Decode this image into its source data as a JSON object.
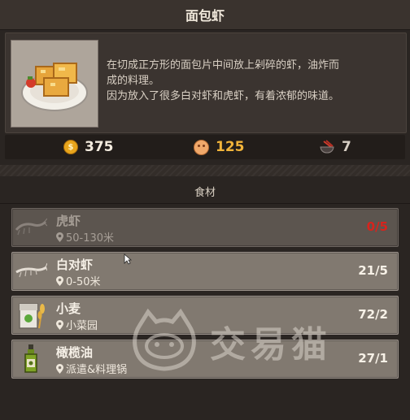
{
  "header": {
    "title": "面包虾"
  },
  "dish": {
    "description_line1": "在切成正方形的面包片中间放上剁碎的虾，油炸而",
    "description_line2": "成的料理。",
    "description_line3": "因为放入了很多白对虾和虎虾，有着浓郁的味道。"
  },
  "stats": {
    "coin": "375",
    "happiness": "125",
    "bowl": "7"
  },
  "section": {
    "title": "食材"
  },
  "ingredients": [
    {
      "name": "虎虾",
      "location": "50-130米",
      "count": "0/5",
      "available": false,
      "icon": "tiger-shrimp-icon"
    },
    {
      "name": "白对虾",
      "location": "0-50米",
      "count": "21/5",
      "available": true,
      "icon": "white-shrimp-icon"
    },
    {
      "name": "小麦",
      "location": "小菜园",
      "count": "72/2",
      "available": true,
      "icon": "wheat-icon"
    },
    {
      "name": "橄榄油",
      "location": "派遣&料理锅",
      "count": "27/1",
      "available": true,
      "icon": "olive-oil-icon"
    }
  ],
  "watermark": {
    "text": "交易猫"
  },
  "colors": {
    "shortage": "#d8231c",
    "happiness": "#f2b43a",
    "coin": "#e8a51c"
  }
}
